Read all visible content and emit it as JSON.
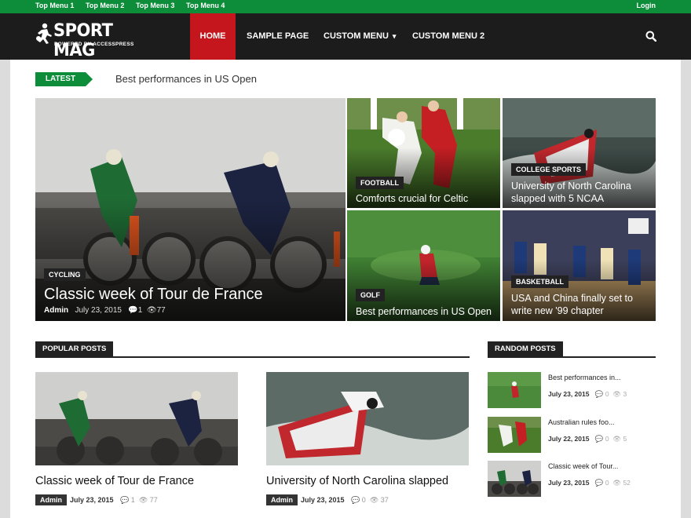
{
  "top_menu": {
    "items": [
      {
        "label": "Top Menu 1"
      },
      {
        "label": "Top Menu 2"
      },
      {
        "label": "Top Menu 3"
      },
      {
        "label": "Top Menu 4"
      }
    ],
    "login": "Login"
  },
  "brand": {
    "name": "SPORT MAG",
    "tagline": "POWERED BY ACCESSPRESS"
  },
  "nav": {
    "items": [
      {
        "label": "HOME"
      },
      {
        "label": "SAMPLE PAGE"
      },
      {
        "label": "CUSTOM MENU"
      },
      {
        "label": "CUSTOM MENU 2"
      }
    ],
    "chevron": "▾",
    "search_icon": "search-icon"
  },
  "ticker": {
    "label": "LATEST",
    "text": "Best performances in US Open"
  },
  "featured": {
    "main": {
      "category": "CYCLING",
      "title": "Classic week of Tour de France",
      "author": "Admin",
      "date": "July 23, 2015",
      "comments": "1",
      "views": "77"
    },
    "tiles": [
      {
        "category": "FOOTBALL",
        "title": "Comforts crucial for Celtic"
      },
      {
        "category": "COLLEGE SPORTS",
        "title": "University of North Carolina slapped with 5 NCAA"
      },
      {
        "category": "GOLF",
        "title": "Best performances in US Open"
      },
      {
        "category": "BASKETBALL",
        "title": "USA and China finally set to write new '99 chapter"
      }
    ]
  },
  "popular": {
    "heading": "POPULAR POSTS",
    "posts": [
      {
        "title": "Classic week of Tour de France",
        "author": "Admin",
        "date": "July 23, 2015",
        "comments": "1",
        "views": "77"
      },
      {
        "title": "University of North Carolina slapped",
        "author": "Admin",
        "date": "July 23, 2015",
        "comments": "0",
        "views": "37"
      }
    ]
  },
  "random": {
    "heading": "RANDOM POSTS",
    "posts": [
      {
        "title": "Best performances in...",
        "date": "July 23, 2015",
        "comments": "0",
        "views": "3"
      },
      {
        "title": "Australian rules foo...",
        "date": "July 22, 2015",
        "comments": "0",
        "views": "5"
      },
      {
        "title": "Classic week of Tour...",
        "date": "July 23, 2015",
        "comments": "0",
        "views": "52"
      }
    ]
  },
  "colors": {
    "brand_green": "#0d8c3a",
    "nav_dark": "#1c1c1c",
    "active_red": "#c4161c"
  }
}
